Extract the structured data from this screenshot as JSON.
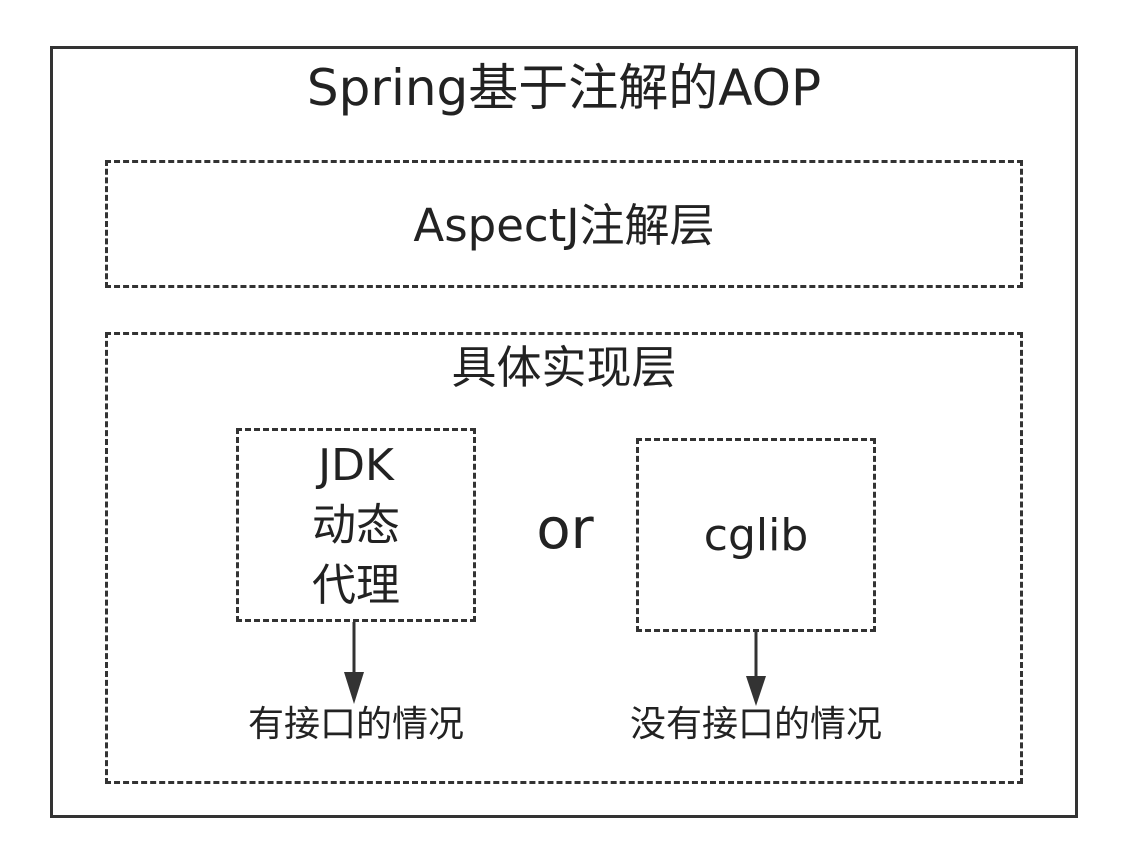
{
  "title": "Spring基于注解的AOP",
  "aspect_layer": {
    "label": "AspectJ注解层"
  },
  "impl_layer": {
    "label": "具体实现层",
    "jdk": {
      "lines": [
        "JDK",
        "动态",
        "代理"
      ],
      "case": "有接口的情况"
    },
    "connector": "or",
    "cglib": {
      "label": "cglib",
      "case": "没有接口的情况"
    }
  },
  "colors": {
    "line": "#333333",
    "text": "#222222",
    "background": "#ffffff"
  }
}
